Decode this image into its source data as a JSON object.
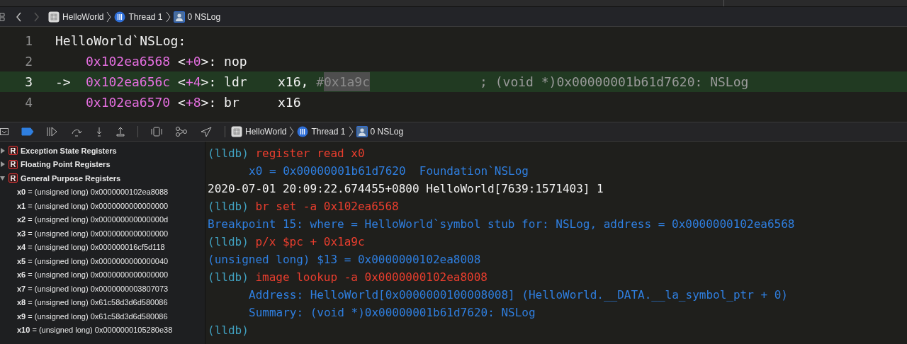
{
  "navigator": {
    "back_enabled": true,
    "forward_enabled": false,
    "path": [
      {
        "kind": "app",
        "label": "HelloWorld"
      },
      {
        "kind": "thread",
        "label": "Thread 1"
      },
      {
        "kind": "frame",
        "label": "0 NSLog"
      }
    ]
  },
  "code": {
    "lines": [
      {
        "number": "1",
        "current": false,
        "segments": [
          {
            "kind": "plain",
            "text": "HelloWorld`NSLog:"
          }
        ]
      },
      {
        "number": "2",
        "current": false,
        "segments": [
          {
            "kind": "address",
            "text": "0x102ea6568"
          },
          {
            "kind": "plain",
            "text": " <"
          },
          {
            "kind": "offset",
            "text": "+0"
          },
          {
            "kind": "plain",
            "text": ">: nop"
          }
        ]
      },
      {
        "number": "3",
        "current": true,
        "arrow": "->",
        "segments": [
          {
            "kind": "address",
            "text": "0x102ea656c"
          },
          {
            "kind": "plain",
            "text": " <"
          },
          {
            "kind": "offset",
            "text": "+4"
          },
          {
            "kind": "plain",
            "text": ">: ldr    x16, "
          },
          {
            "kind": "dim",
            "text": "#"
          },
          {
            "kind": "selected",
            "text": "0x1a9c"
          },
          {
            "kind": "comment",
            "text": "; (void *)0x00000001b61d7620: NSLog"
          }
        ]
      },
      {
        "number": "4",
        "current": false,
        "segments": [
          {
            "kind": "address",
            "text": "0x102ea6570"
          },
          {
            "kind": "plain",
            "text": " <"
          },
          {
            "kind": "offset",
            "text": "+8"
          },
          {
            "kind": "plain",
            "text": ">: br     x16"
          }
        ]
      }
    ]
  },
  "debug_bar": {
    "breakpoints_active": true,
    "path": [
      {
        "kind": "app",
        "label": "HelloWorld"
      },
      {
        "kind": "thread",
        "label": "Thread 1"
      },
      {
        "kind": "frame",
        "label": "0 NSLog"
      }
    ]
  },
  "variables": [
    {
      "label": "Exception State Registers",
      "expanded": false
    },
    {
      "label": "Floating Point Registers",
      "expanded": false
    },
    {
      "label": "General Purpose Registers",
      "expanded": true,
      "registers": [
        "**x0** = (unsigned long) 0x0000000102ea8088",
        "**x1** = (unsigned long) 0x0000000000000000",
        "**x2** = (unsigned long) 0x000000000000000d",
        "**x3** = (unsigned long) 0x0000000000000000",
        "**x4** = (unsigned long) 0x000000016cf5d118",
        "**x5** = (unsigned long) 0x0000000000000040",
        "**x6** = (unsigned long) 0x0000000000000000",
        "**x7** = (unsigned long) 0x0000000003807073",
        "**x8** = (unsigned long) 0x61c58d3d6d580086",
        "**x9** = (unsigned long) 0x61c58d3d6d580086",
        "**x10** = (unsigned long) 0x0000000105280e38"
      ]
    }
  ],
  "console": [
    {
      "indent": false,
      "segments": [
        {
          "kind": "prompt",
          "text": "(lldb) "
        },
        {
          "kind": "command",
          "text": "register read x0"
        }
      ]
    },
    {
      "indent": true,
      "segments": [
        {
          "kind": "output",
          "text": "x0 = 0x00000001b61d7620  Foundation`NSLog"
        }
      ]
    },
    {
      "indent": false,
      "segments": [
        {
          "kind": "log",
          "text": "2020-07-01 20:09:22.674455+0800 HelloWorld[7639:1571403] 1"
        }
      ]
    },
    {
      "indent": false,
      "segments": [
        {
          "kind": "prompt",
          "text": "(lldb) "
        },
        {
          "kind": "command",
          "text": "br set -a 0x102ea6568"
        }
      ]
    },
    {
      "indent": false,
      "segments": [
        {
          "kind": "output",
          "text": "Breakpoint 15: where = HelloWorld`symbol stub for: NSLog, address = 0x0000000102ea6568"
        }
      ]
    },
    {
      "indent": false,
      "segments": [
        {
          "kind": "prompt",
          "text": "(lldb) "
        },
        {
          "kind": "command",
          "text": "p/x $pc + 0x1a9c"
        }
      ]
    },
    {
      "indent": false,
      "segments": [
        {
          "kind": "output",
          "text": "(unsigned long) $13 = 0x0000000102ea8008"
        }
      ]
    },
    {
      "indent": false,
      "segments": [
        {
          "kind": "prompt",
          "text": "(lldb) "
        },
        {
          "kind": "command",
          "text": "image lookup -a 0x0000000102ea8008"
        }
      ]
    },
    {
      "indent": true,
      "segments": [
        {
          "kind": "output",
          "text": "Address: HelloWorld[0x0000000100008008] (HelloWorld.__DATA.__la_symbol_ptr + 0)"
        }
      ]
    },
    {
      "indent": true,
      "segments": [
        {
          "kind": "output",
          "text": "Summary: (void *)0x00000001b61d7620: NSLog"
        }
      ]
    },
    {
      "indent": false,
      "segments": [
        {
          "kind": "prompt",
          "text": "(lldb)"
        }
      ]
    }
  ]
}
